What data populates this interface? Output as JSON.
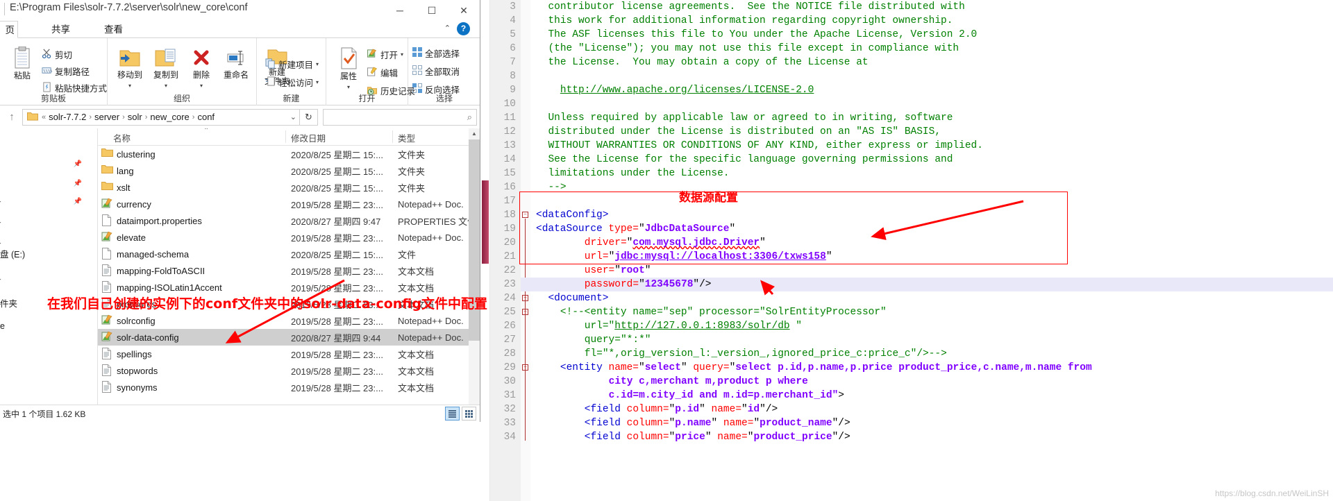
{
  "explorer": {
    "title_path": "E:\\Program Files\\solr-7.7.2\\server\\solr\\new_core\\conf",
    "window_controls": {
      "minimize": "─",
      "maximize": "☐",
      "close": "✕"
    },
    "ribbon_tabs": [
      {
        "label": "页",
        "name": "tab-home"
      },
      {
        "label": "共享",
        "name": "tab-share"
      },
      {
        "label": "查看",
        "name": "tab-view"
      }
    ],
    "help_button": "?",
    "collapse_ribbon": "⌃",
    "ribbon_groups": [
      {
        "label": "剪贴板",
        "big": [
          {
            "label": "粘贴",
            "icon": "clipboard-icon"
          }
        ],
        "small": [
          {
            "label": "剪切",
            "icon": "scissors-icon"
          },
          {
            "label": "复制路径",
            "icon": "copy-path-icon"
          },
          {
            "label": "粘贴快捷方式",
            "icon": "paste-shortcut-icon"
          }
        ]
      },
      {
        "label": "组织",
        "big": [
          {
            "label": "移动到",
            "icon": "move-to-icon"
          },
          {
            "label": "复制到",
            "icon": "copy-to-icon"
          },
          {
            "label": "删除",
            "icon": "delete-icon"
          },
          {
            "label": "重命名",
            "icon": "rename-icon"
          }
        ],
        "small": []
      },
      {
        "label": "新建",
        "big": [
          {
            "label": "新建\n文件夹",
            "icon": "new-folder-icon"
          }
        ],
        "small": [
          {
            "label": "新建项目",
            "icon": "new-item-icon"
          },
          {
            "label": "轻松访问",
            "icon": "easy-access-icon"
          }
        ]
      },
      {
        "label": "打开",
        "big": [
          {
            "label": "属性",
            "icon": "properties-icon"
          }
        ],
        "small": [
          {
            "label": "打开",
            "icon": "open-icon"
          },
          {
            "label": "编辑",
            "icon": "edit-icon"
          },
          {
            "label": "历史记录",
            "icon": "history-icon"
          }
        ]
      },
      {
        "label": "选择",
        "big": [],
        "small": [
          {
            "label": "全部选择",
            "icon": "select-all-icon"
          },
          {
            "label": "全部取消",
            "icon": "select-none-icon"
          },
          {
            "label": "反向选择",
            "icon": "invert-selection-icon"
          }
        ]
      }
    ],
    "address": {
      "up_icon": "↑",
      "root": "«",
      "breadcrumbs": [
        "solr-7.7.2",
        "server",
        "solr",
        "new_core",
        "conf"
      ],
      "dropdown_caret": "⌄",
      "refresh_icon": "↻",
      "search_placeholder": "",
      "search_icon": "⌕"
    },
    "columns": [
      "名称",
      "修改日期",
      "类型"
    ],
    "sort_indicator": "⌃",
    "files": [
      {
        "name": "clustering",
        "date": "2020/8/25 星期二 15:...",
        "type": "文件夹",
        "icon": "folder-icon",
        "selected": false
      },
      {
        "name": "lang",
        "date": "2020/8/25 星期二 15:...",
        "type": "文件夹",
        "icon": "folder-icon",
        "selected": false
      },
      {
        "name": "xslt",
        "date": "2020/8/25 星期二 15:...",
        "type": "文件夹",
        "icon": "folder-icon",
        "selected": false
      },
      {
        "name": "currency",
        "date": "2019/5/28 星期二 23:...",
        "type": "Notepad++ Doc.",
        "icon": "notepad-icon",
        "selected": false
      },
      {
        "name": "dataimport.properties",
        "date": "2020/8/27 星期四 9:47",
        "type": "PROPERTIES 文件",
        "icon": "doc-icon",
        "selected": false
      },
      {
        "name": "elevate",
        "date": "2019/5/28 星期二 23:...",
        "type": "Notepad++ Doc.",
        "icon": "notepad-icon",
        "selected": false
      },
      {
        "name": "managed-schema",
        "date": "2020/8/25 星期二 15:...",
        "type": "文件",
        "icon": "doc-icon",
        "selected": false
      },
      {
        "name": "mapping-FoldToASCII",
        "date": "2019/5/28 星期二 23:...",
        "type": "文本文档",
        "icon": "text-icon",
        "selected": false
      },
      {
        "name": "mapping-ISOLatin1Accent",
        "date": "2019/5/28 星期二 23:...",
        "type": "文本文档",
        "icon": "text-icon",
        "selected": false
      },
      {
        "name": "protwords",
        "date": "2019/5/28 星期二 23:...",
        "type": "文本文档",
        "icon": "text-icon",
        "selected": false
      },
      {
        "name": "solrconfig",
        "date": "2019/5/28 星期二 23:...",
        "type": "Notepad++ Doc.",
        "icon": "notepad-icon",
        "selected": false
      },
      {
        "name": "solr-data-config",
        "date": "2020/8/27 星期四 9:44",
        "type": "Notepad++ Doc.",
        "icon": "notepad-icon",
        "selected": true
      },
      {
        "name": "spellings",
        "date": "2019/5/28 星期二 23:...",
        "type": "文本文档",
        "icon": "text-icon",
        "selected": false
      },
      {
        "name": "stopwords",
        "date": "2019/5/28 星期二 23:...",
        "type": "文本文档",
        "icon": "text-icon",
        "selected": false
      },
      {
        "name": "synonyms",
        "date": "2019/5/28 星期二 23:...",
        "type": "文本文档",
        "icon": "text-icon",
        "selected": false
      }
    ],
    "nav_items": [
      {
        "label": "盘 (E:)"
      },
      {
        "label": "件夹"
      },
      {
        "label": "e"
      }
    ],
    "status": "选中 1 个项目  1.62 KB"
  },
  "editor": {
    "lines": [
      {
        "n": 3,
        "indent": 2,
        "segs": [
          {
            "t": "contributor license agreements.  See the NOTICE file distributed with",
            "c": "c-comment"
          }
        ]
      },
      {
        "n": 4,
        "indent": 2,
        "segs": [
          {
            "t": "this work for additional information regarding copyright ownership.",
            "c": "c-comment"
          }
        ]
      },
      {
        "n": 5,
        "indent": 2,
        "segs": [
          {
            "t": "The ASF licenses this file to You under the Apache License, Version 2.0",
            "c": "c-comment"
          }
        ]
      },
      {
        "n": 6,
        "indent": 2,
        "segs": [
          {
            "t": "(the \"License\"); you may not use this file except in compliance with",
            "c": "c-comment"
          }
        ]
      },
      {
        "n": 7,
        "indent": 2,
        "segs": [
          {
            "t": "the License.  You may obtain a copy of the License at",
            "c": "c-comment"
          }
        ]
      },
      {
        "n": 8,
        "indent": 2,
        "segs": []
      },
      {
        "n": 9,
        "indent": 4,
        "segs": [
          {
            "t": "http://www.apache.org/licenses/LICENSE-2.0",
            "c": "c-comment ul"
          }
        ]
      },
      {
        "n": 10,
        "indent": 2,
        "segs": []
      },
      {
        "n": 11,
        "indent": 2,
        "segs": [
          {
            "t": "Unless required by applicable law or agreed to in writing, software",
            "c": "c-comment"
          }
        ]
      },
      {
        "n": 12,
        "indent": 2,
        "segs": [
          {
            "t": "distributed under the License is distributed on an \"AS IS\" BASIS,",
            "c": "c-comment"
          }
        ]
      },
      {
        "n": 13,
        "indent": 2,
        "segs": [
          {
            "t": "WITHOUT WARRANTIES OR CONDITIONS OF ANY KIND, either express or implied.",
            "c": "c-comment"
          }
        ]
      },
      {
        "n": 14,
        "indent": 2,
        "segs": [
          {
            "t": "See the License for the specific language governing permissions and",
            "c": "c-comment"
          }
        ]
      },
      {
        "n": 15,
        "indent": 2,
        "segs": [
          {
            "t": "limitations under the License.",
            "c": "c-comment"
          }
        ]
      },
      {
        "n": 16,
        "indent": 2,
        "segs": [
          {
            "t": "-->",
            "c": "c-comment"
          }
        ]
      },
      {
        "n": 17,
        "indent": 0,
        "segs": []
      },
      {
        "n": 18,
        "indent": 0,
        "segs": [
          {
            "t": "<dataConfig>",
            "c": "c-tag"
          }
        ]
      },
      {
        "n": 19,
        "indent": 0,
        "segs": [
          {
            "t": "<dataSource ",
            "c": "c-tag"
          },
          {
            "t": "type=",
            "c": "c-attr"
          },
          {
            "t": "\"",
            "c": "c-punc"
          },
          {
            "t": "JdbcDataSource",
            "c": "c-val"
          },
          {
            "t": "\"",
            "c": "c-punc"
          }
        ]
      },
      {
        "n": 20,
        "indent": 8,
        "segs": [
          {
            "t": "driver=",
            "c": "c-attr"
          },
          {
            "t": "\"",
            "c": "c-punc"
          },
          {
            "t": "com.mysql.jdbc.Driver",
            "c": "c-val sq"
          },
          {
            "t": "\"",
            "c": "c-punc"
          }
        ]
      },
      {
        "n": 21,
        "indent": 8,
        "segs": [
          {
            "t": "url=",
            "c": "c-attr"
          },
          {
            "t": "\"",
            "c": "c-punc"
          },
          {
            "t": "jdbc:mysql://localhost:3306/txws158",
            "c": "c-val ul"
          },
          {
            "t": "\"",
            "c": "c-punc"
          }
        ]
      },
      {
        "n": 22,
        "indent": 8,
        "segs": [
          {
            "t": "user=",
            "c": "c-attr"
          },
          {
            "t": "\"",
            "c": "c-punc"
          },
          {
            "t": "root",
            "c": "c-val"
          },
          {
            "t": "\"",
            "c": "c-punc"
          }
        ]
      },
      {
        "n": 23,
        "indent": 8,
        "segs": [
          {
            "t": "password=",
            "c": "c-attr"
          },
          {
            "t": "\"",
            "c": "c-punc"
          },
          {
            "t": "12345678",
            "c": "c-val"
          },
          {
            "t": "\"/>",
            "c": "c-punc"
          }
        ],
        "highlight": true
      },
      {
        "n": 24,
        "indent": 2,
        "segs": [
          {
            "t": "<document>",
            "c": "c-tag"
          }
        ]
      },
      {
        "n": 25,
        "indent": 4,
        "segs": [
          {
            "t": "<!--<entity name=\"sep\" processor=\"SolrEntityProcessor\"",
            "c": "c-comment"
          }
        ]
      },
      {
        "n": 26,
        "indent": 8,
        "segs": [
          {
            "t": "url=\"",
            "c": "c-comment"
          },
          {
            "t": "http://127.0.0.1:8983/solr/db",
            "c": "c-comment ul"
          },
          {
            "t": " \"",
            "c": "c-comment"
          }
        ]
      },
      {
        "n": 27,
        "indent": 8,
        "segs": [
          {
            "t": "query=\"*:*\"",
            "c": "c-comment"
          }
        ]
      },
      {
        "n": 28,
        "indent": 8,
        "segs": [
          {
            "t": "fl=\"*,orig_version_l:_version_,ignored_price_c:price_c\"/>-->",
            "c": "c-comment"
          }
        ]
      },
      {
        "n": 29,
        "indent": 4,
        "segs": [
          {
            "t": "<entity ",
            "c": "c-tag"
          },
          {
            "t": "name=",
            "c": "c-attr"
          },
          {
            "t": "\"",
            "c": "c-punc"
          },
          {
            "t": "select",
            "c": "c-val"
          },
          {
            "t": "\" ",
            "c": "c-punc"
          },
          {
            "t": "query=",
            "c": "c-attr"
          },
          {
            "t": "\"",
            "c": "c-punc"
          },
          {
            "t": "select p.id,p.name,p.price product_price,c.name,m.name from",
            "c": "c-val"
          }
        ]
      },
      {
        "n": 30,
        "indent": 12,
        "segs": [
          {
            "t": "city c,merchant m,product p where",
            "c": "c-val"
          }
        ]
      },
      {
        "n": 31,
        "indent": 12,
        "segs": [
          {
            "t": "c.id=m.city_id and m.id=p.merchant_id\"",
            "c": "c-val"
          },
          {
            "t": ">",
            "c": "c-punc"
          }
        ]
      },
      {
        "n": 32,
        "indent": 8,
        "segs": [
          {
            "t": "<field ",
            "c": "c-tag"
          },
          {
            "t": "column=",
            "c": "c-attr"
          },
          {
            "t": "\"",
            "c": "c-punc"
          },
          {
            "t": "p.id",
            "c": "c-val"
          },
          {
            "t": "\" ",
            "c": "c-punc"
          },
          {
            "t": "name=",
            "c": "c-attr"
          },
          {
            "t": "\"",
            "c": "c-punc"
          },
          {
            "t": "id",
            "c": "c-val"
          },
          {
            "t": "\"/>",
            "c": "c-punc"
          }
        ]
      },
      {
        "n": 33,
        "indent": 8,
        "segs": [
          {
            "t": "<field ",
            "c": "c-tag"
          },
          {
            "t": "column=",
            "c": "c-attr"
          },
          {
            "t": "\"",
            "c": "c-punc"
          },
          {
            "t": "p.name",
            "c": "c-val"
          },
          {
            "t": "\" ",
            "c": "c-punc"
          },
          {
            "t": "name=",
            "c": "c-attr"
          },
          {
            "t": "\"",
            "c": "c-punc"
          },
          {
            "t": "product_name",
            "c": "c-val"
          },
          {
            "t": "\"/>",
            "c": "c-punc"
          }
        ]
      },
      {
        "n": 34,
        "indent": 8,
        "segs": [
          {
            "t": "<field ",
            "c": "c-tag"
          },
          {
            "t": "column=",
            "c": "c-attr"
          },
          {
            "t": "\"",
            "c": "c-punc"
          },
          {
            "t": "price",
            "c": "c-val"
          },
          {
            "t": "\" ",
            "c": "c-punc"
          },
          {
            "t": "name=",
            "c": "c-attr"
          },
          {
            "t": "\"",
            "c": "c-punc"
          },
          {
            "t": "product_price",
            "c": "c-val"
          },
          {
            "t": "\"/>",
            "c": "c-punc"
          }
        ]
      }
    ],
    "watermark": "https://blog.csdn.net/WeiLinSH"
  },
  "annotations": {
    "datasource_label": "数据源配置",
    "path_note": "在我们自己创建的实例下的conf文件夹中的solr-data-config文件中配置",
    "accent_color": "#ff0000"
  }
}
